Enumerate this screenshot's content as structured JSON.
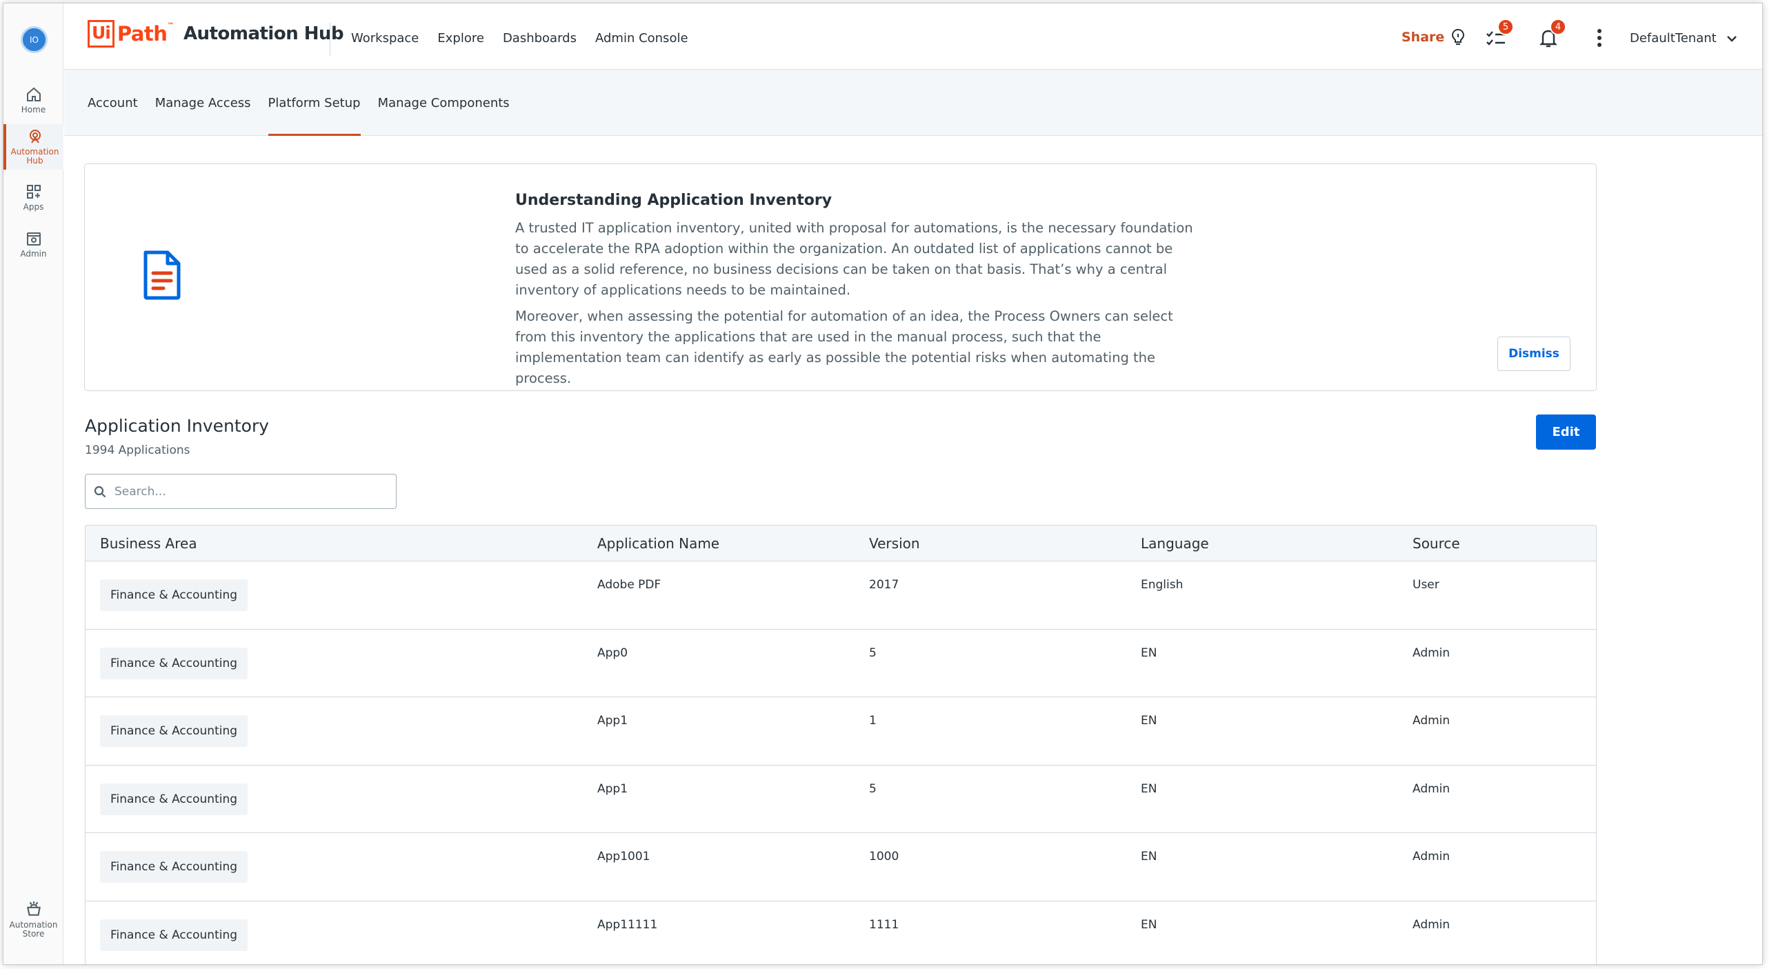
{
  "user": {
    "initials": "IO"
  },
  "rail": {
    "items": [
      {
        "label": "Home",
        "icon": "home-icon"
      },
      {
        "label": "Automation Hub",
        "icon": "automation-hub-icon"
      },
      {
        "label": "Apps",
        "icon": "apps-icon"
      },
      {
        "label": "Admin",
        "icon": "admin-icon"
      }
    ],
    "bottom": {
      "label": "Automation Store",
      "icon": "automation-store-icon"
    }
  },
  "brand": {
    "ui": "Ui",
    "path": "Path",
    "tm": "™",
    "product": "Automation Hub",
    "color": "#fa4616"
  },
  "topnav": [
    "Workspace",
    "Explore",
    "Dashboards",
    "Admin Console"
  ],
  "header": {
    "share_label": "Share",
    "tasks_badge": "5",
    "notifications_badge": "4",
    "tenant": "DefaultTenant"
  },
  "subnav": {
    "tabs": [
      "Account",
      "Manage Access",
      "Platform Setup",
      "Manage Components"
    ],
    "active": "Platform Setup"
  },
  "info": {
    "title": "Understanding Application Inventory",
    "p1": "A trusted IT application inventory, united with proposal for automations, is the necessary foundation to accelerate the RPA adoption within the organization. An outdated list of applications cannot be used as a solid reference, no business decisions can be taken on that basis. That’s why a central inventory of applications needs to be maintained.",
    "p2": "Moreover, when assessing the potential for automation of an idea, the Process Owners can select from this inventory the applications that are used in the manual process, such that the implementation team can identify as early as possible the potential risks when automating the process.",
    "dismiss_label": "Dismiss"
  },
  "inventory": {
    "title": "Application Inventory",
    "count": "1994 Applications",
    "edit_label": "Edit",
    "search_placeholder": "Search...",
    "columns": [
      "Business Area",
      "Application Name",
      "Version",
      "Language",
      "Source"
    ],
    "rows": [
      {
        "area": "Finance & Accounting",
        "name": "Adobe PDF",
        "version": "2017",
        "language": "English",
        "source": "User"
      },
      {
        "area": "Finance & Accounting",
        "name": "App0",
        "version": "5",
        "language": "EN",
        "source": "Admin"
      },
      {
        "area": "Finance & Accounting",
        "name": "App1",
        "version": "1",
        "language": "EN",
        "source": "Admin"
      },
      {
        "area": "Finance & Accounting",
        "name": "App1",
        "version": "5",
        "language": "EN",
        "source": "Admin"
      },
      {
        "area": "Finance & Accounting",
        "name": "App1001",
        "version": "1000",
        "language": "EN",
        "source": "Admin"
      },
      {
        "area": "Finance & Accounting",
        "name": "App11111",
        "version": "1111",
        "language": "EN",
        "source": "Admin"
      }
    ]
  },
  "colors": {
    "accent": "#c94f22",
    "primary": "#0067df",
    "badge": "#e0401b"
  }
}
